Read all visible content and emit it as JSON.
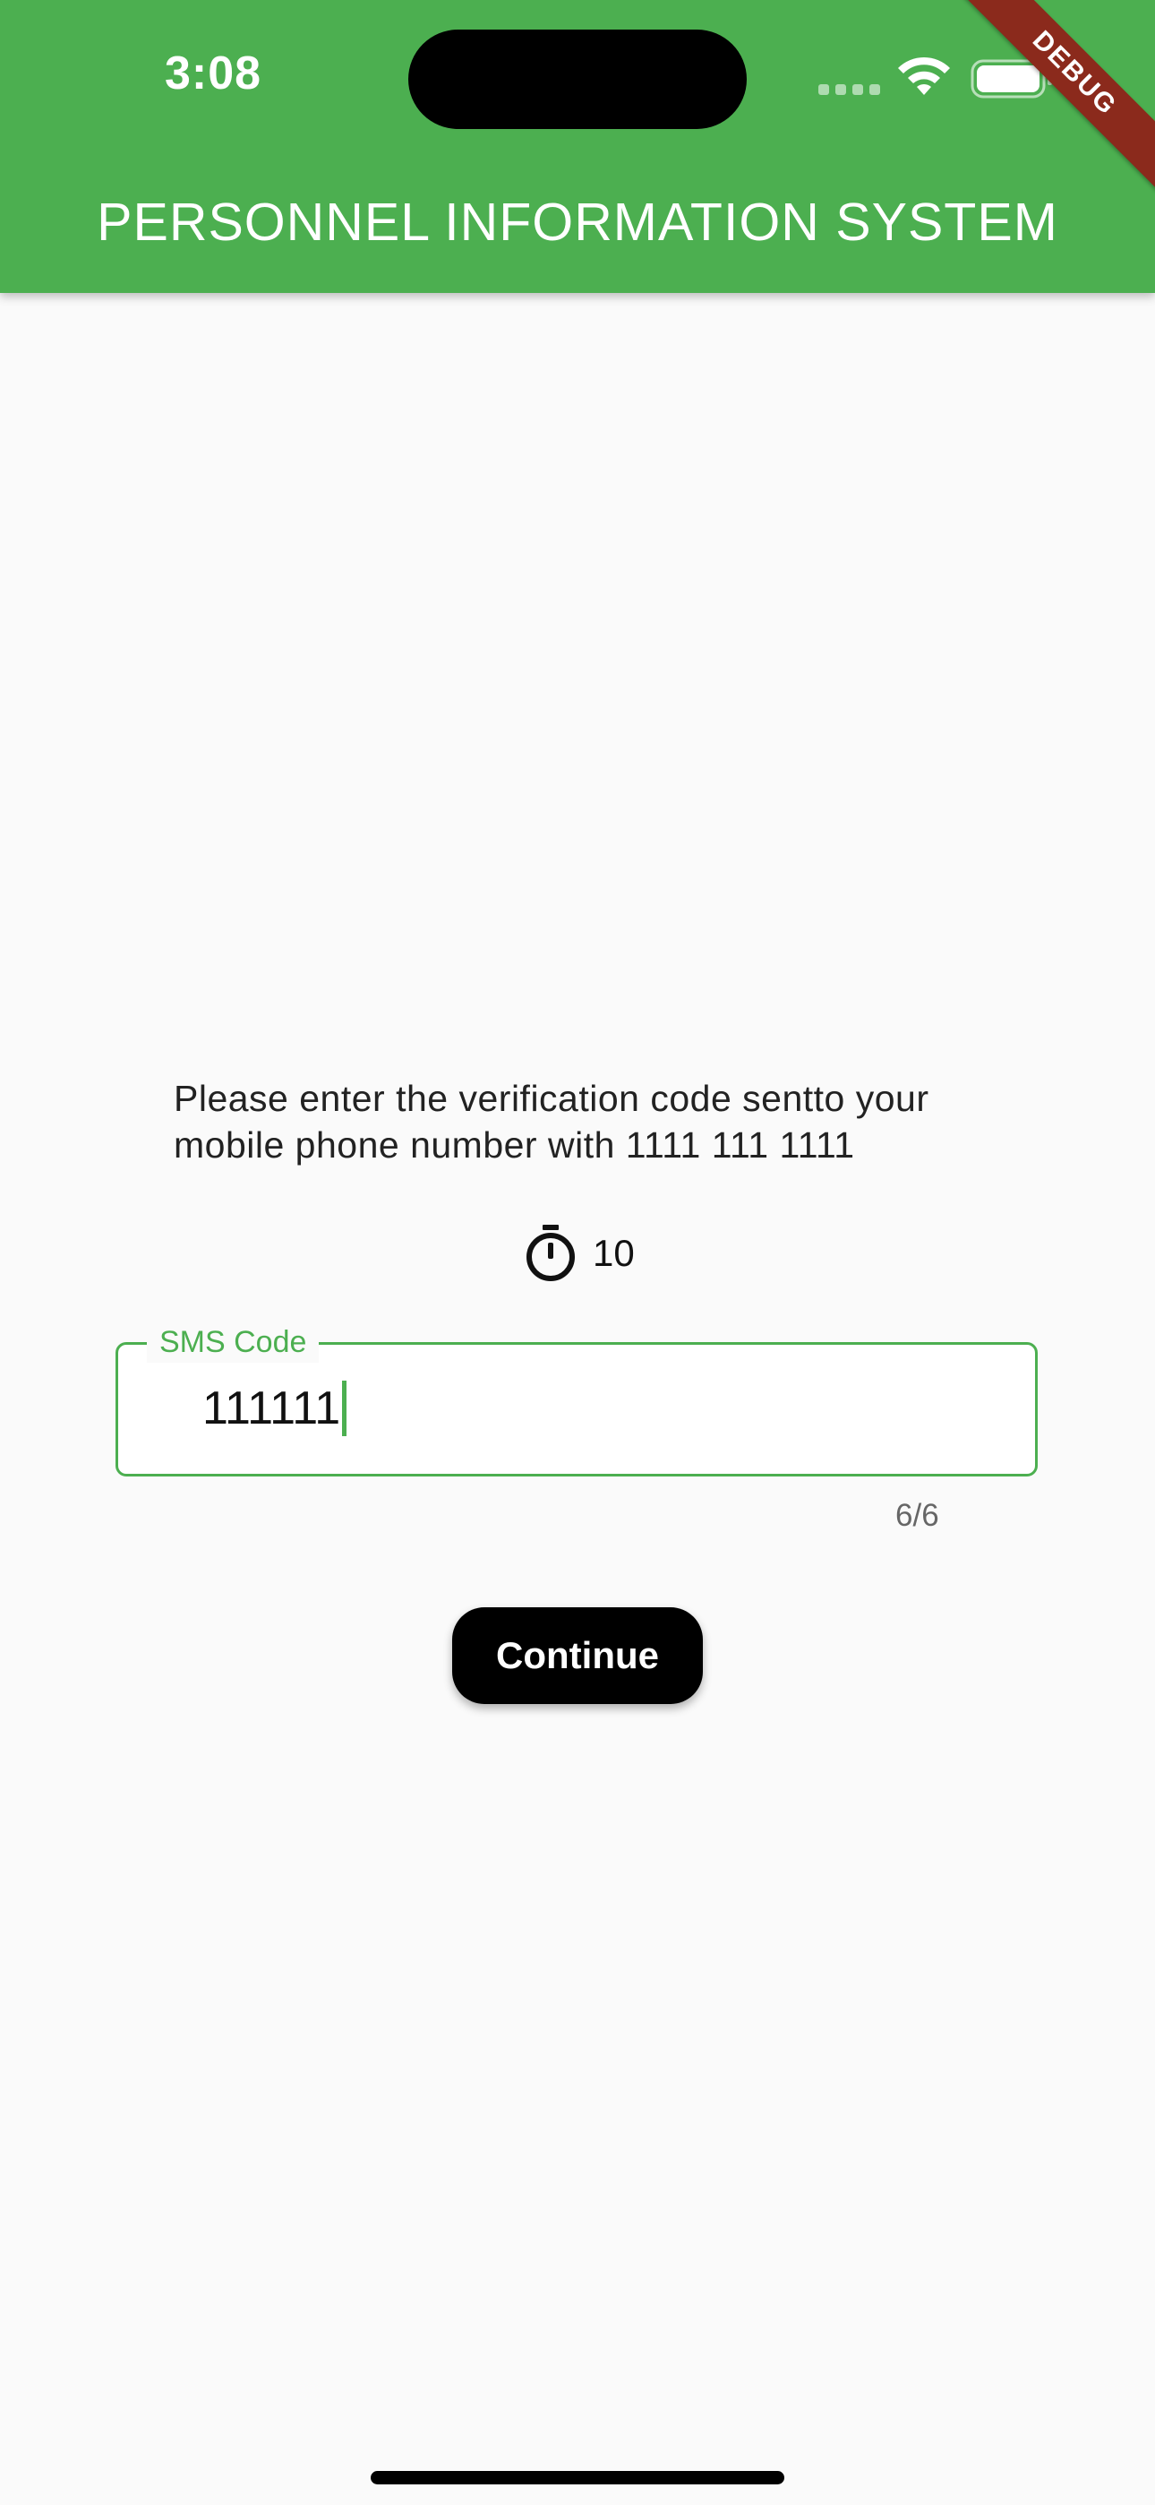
{
  "status_bar": {
    "time": "3:08",
    "wifi_icon": "wifi-icon",
    "battery_icon": "battery-icon",
    "signal_icon": "cellular-dots-icon"
  },
  "app_bar": {
    "title": "PERSONNEL INFORMATION SYSTEM",
    "background_color": "#4caf50",
    "debug_banner": "DEBUG"
  },
  "verification": {
    "instructions": "Please enter the verification code sentto your mobile phone number with 1111 111 1111",
    "timer_icon": "stopwatch-icon",
    "timer_value": "10",
    "sms_field": {
      "label": "SMS Code",
      "value": "111111",
      "counter": "6/6",
      "accent_color": "#4caf50"
    },
    "continue_label": "Continue"
  }
}
